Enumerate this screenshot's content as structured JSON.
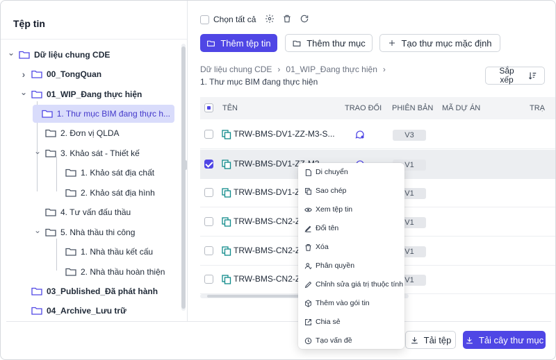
{
  "left_panel": {
    "title": "Tệp tin",
    "tree": [
      {
        "label": "Dữ liệu chung CDE",
        "bold": true,
        "level": 0,
        "expanded": true,
        "selected": false
      },
      {
        "label": "00_TongQuan",
        "bold": true,
        "level": 1,
        "expanded": false,
        "selected": false
      },
      {
        "label": "01_WIP_Đang thực hiện",
        "bold": true,
        "level": 1,
        "expanded": true,
        "selected": false
      },
      {
        "label": "1. Thư mục BIM đang thực h...",
        "bold": false,
        "level": 2,
        "expanded": false,
        "selected": true
      },
      {
        "label": "2. Đơn vị QLDA",
        "bold": false,
        "level": 2,
        "expanded": false,
        "selected": false
      },
      {
        "label": "3. Khảo sát - Thiết kế",
        "bold": false,
        "level": 2,
        "expanded": true,
        "selected": false
      },
      {
        "label": "1. Khảo sát địa chất",
        "bold": false,
        "level": 3,
        "expanded": false,
        "selected": false
      },
      {
        "label": "2. Khảo sát địa hình",
        "bold": false,
        "level": 3,
        "expanded": false,
        "selected": false
      },
      {
        "label": "4. Tư vấn đấu thầu",
        "bold": false,
        "level": 2,
        "expanded": false,
        "selected": false
      },
      {
        "label": "5. Nhà thầu thi công",
        "bold": false,
        "level": 2,
        "expanded": true,
        "selected": false
      },
      {
        "label": "1. Nhà thầu kết cấu",
        "bold": false,
        "level": 3,
        "expanded": false,
        "selected": false
      },
      {
        "label": "2. Nhà thầu hoàn thiện",
        "bold": false,
        "level": 3,
        "expanded": false,
        "selected": false
      },
      {
        "label": "03_Published_Đã phát hành",
        "bold": true,
        "level": 1,
        "expanded": false,
        "selected": false
      },
      {
        "label": "04_Archive_Lưu trữ",
        "bold": true,
        "level": 1,
        "expanded": false,
        "selected": false
      }
    ]
  },
  "toolbar": {
    "select_all": "Chọn tất cả",
    "add_file": "Thêm tệp tin",
    "add_folder": "Thêm thư mục",
    "create_default_folder": "Tạo thư mục mặc định"
  },
  "breadcrumb": {
    "items": [
      "Dữ liệu chung CDE",
      "01_WIP_Đang thực hiện"
    ],
    "current": "1. Thư mục BIM đang thực hiện"
  },
  "sort": {
    "label_line1": "Sắp",
    "label_line2": "xếp"
  },
  "table": {
    "columns": [
      "TÊN",
      "TRAO ĐỔI",
      "PHIÊN BẢN",
      "MÃ DỰ ÁN",
      "TRẠ"
    ],
    "rows": [
      {
        "name": "TRW-BMS-DV1-ZZ-M3-S...",
        "version": "V3",
        "checked": false,
        "discussion": true
      },
      {
        "name": "TRW-BMS-DV1-ZZ-M3-...",
        "version": "V1",
        "checked": true,
        "discussion": true
      },
      {
        "name": "TRW-BMS-DV1-Z",
        "version": "V1",
        "checked": false,
        "discussion": false
      },
      {
        "name": "TRW-BMS-CN2-Z",
        "version": "V1",
        "checked": false,
        "discussion": false
      },
      {
        "name": "TRW-BMS-CN2-Z",
        "version": "V1",
        "checked": false,
        "discussion": false
      },
      {
        "name": "TRW-BMS-CN2-Z",
        "version": "V1",
        "checked": false,
        "discussion": false
      }
    ]
  },
  "context_menu": [
    {
      "label": "Di chuyển",
      "icon": "move-icon"
    },
    {
      "label": "Sao chép",
      "icon": "copy-icon"
    },
    {
      "label": "Xem tệp tin",
      "icon": "eye-icon"
    },
    {
      "label": "Đổi tên",
      "icon": "rename-icon"
    },
    {
      "label": "Xóa",
      "icon": "trash-icon"
    },
    {
      "label": "Phân quyền",
      "icon": "permission-icon"
    },
    {
      "label": "Chỉnh sửa giá trị thuộc tính",
      "icon": "edit-icon"
    },
    {
      "label": "Thêm vào gói tin",
      "icon": "package-icon"
    },
    {
      "label": "Chia sẻ",
      "icon": "share-icon"
    },
    {
      "label": "Tạo vấn đề",
      "icon": "issue-icon"
    }
  ],
  "footer": {
    "download_file": "Tải tệp",
    "download_tree": "Tải cây thư mục"
  },
  "colors": {
    "accent": "#4f46e5",
    "selected_bg": "#d9dcfb",
    "teal_file": "#0f8a8a"
  }
}
